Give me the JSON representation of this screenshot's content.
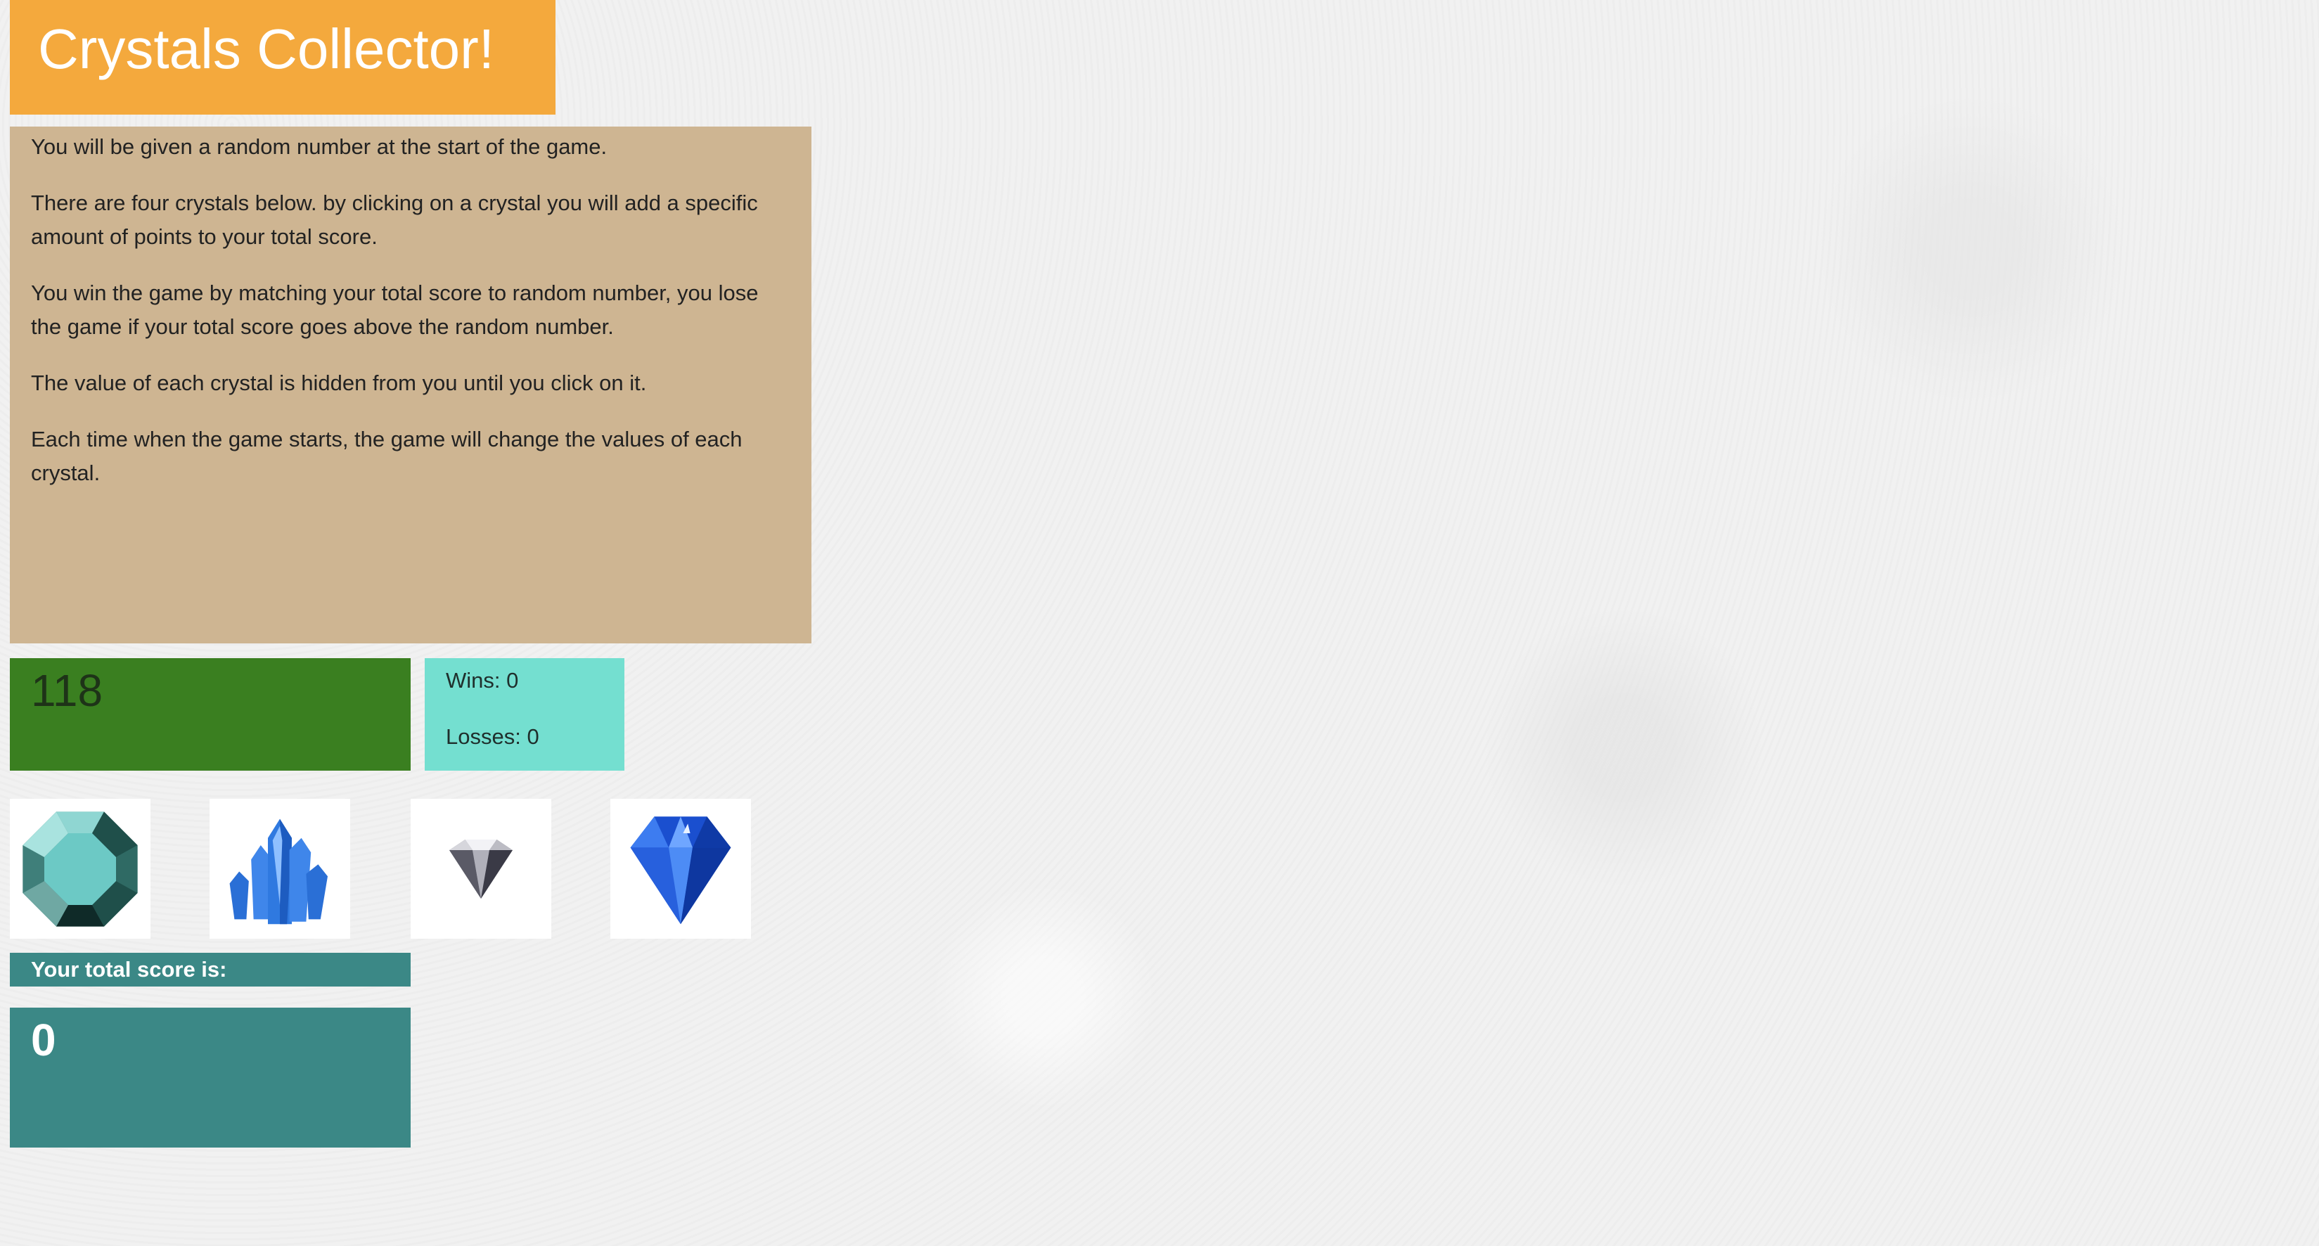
{
  "header": {
    "title": "Crystals Collector!"
  },
  "instructions": [
    "You will be given a random number at the start of the game.",
    "There are four crystals below. by clicking on a crystal you will add a specific amount of points to your total score.",
    "You win the game by matching your total score to random number, you lose the game if your total score goes above the random number.",
    "The value of each crystal is hidden from you until you click on it.",
    "Each time when the game starts, the game will change the values of each crystal."
  ],
  "target_number": "118",
  "stats": {
    "wins": "Wins: 0",
    "losses": "Losses: 0"
  },
  "crystals": [
    {
      "icon": "teal-octagon-gem-icon"
    },
    {
      "icon": "blue-crystal-cluster-icon"
    },
    {
      "icon": "clear-diamond-icon"
    },
    {
      "icon": "blue-sapphire-icon"
    }
  ],
  "score": {
    "label": "Your total score is:",
    "value": "0"
  },
  "colors": {
    "header": "#f4a93d",
    "instructions": "#ceb592",
    "target": "#3a7f20",
    "stats": "#74dfd0",
    "score": "#3b8886"
  }
}
